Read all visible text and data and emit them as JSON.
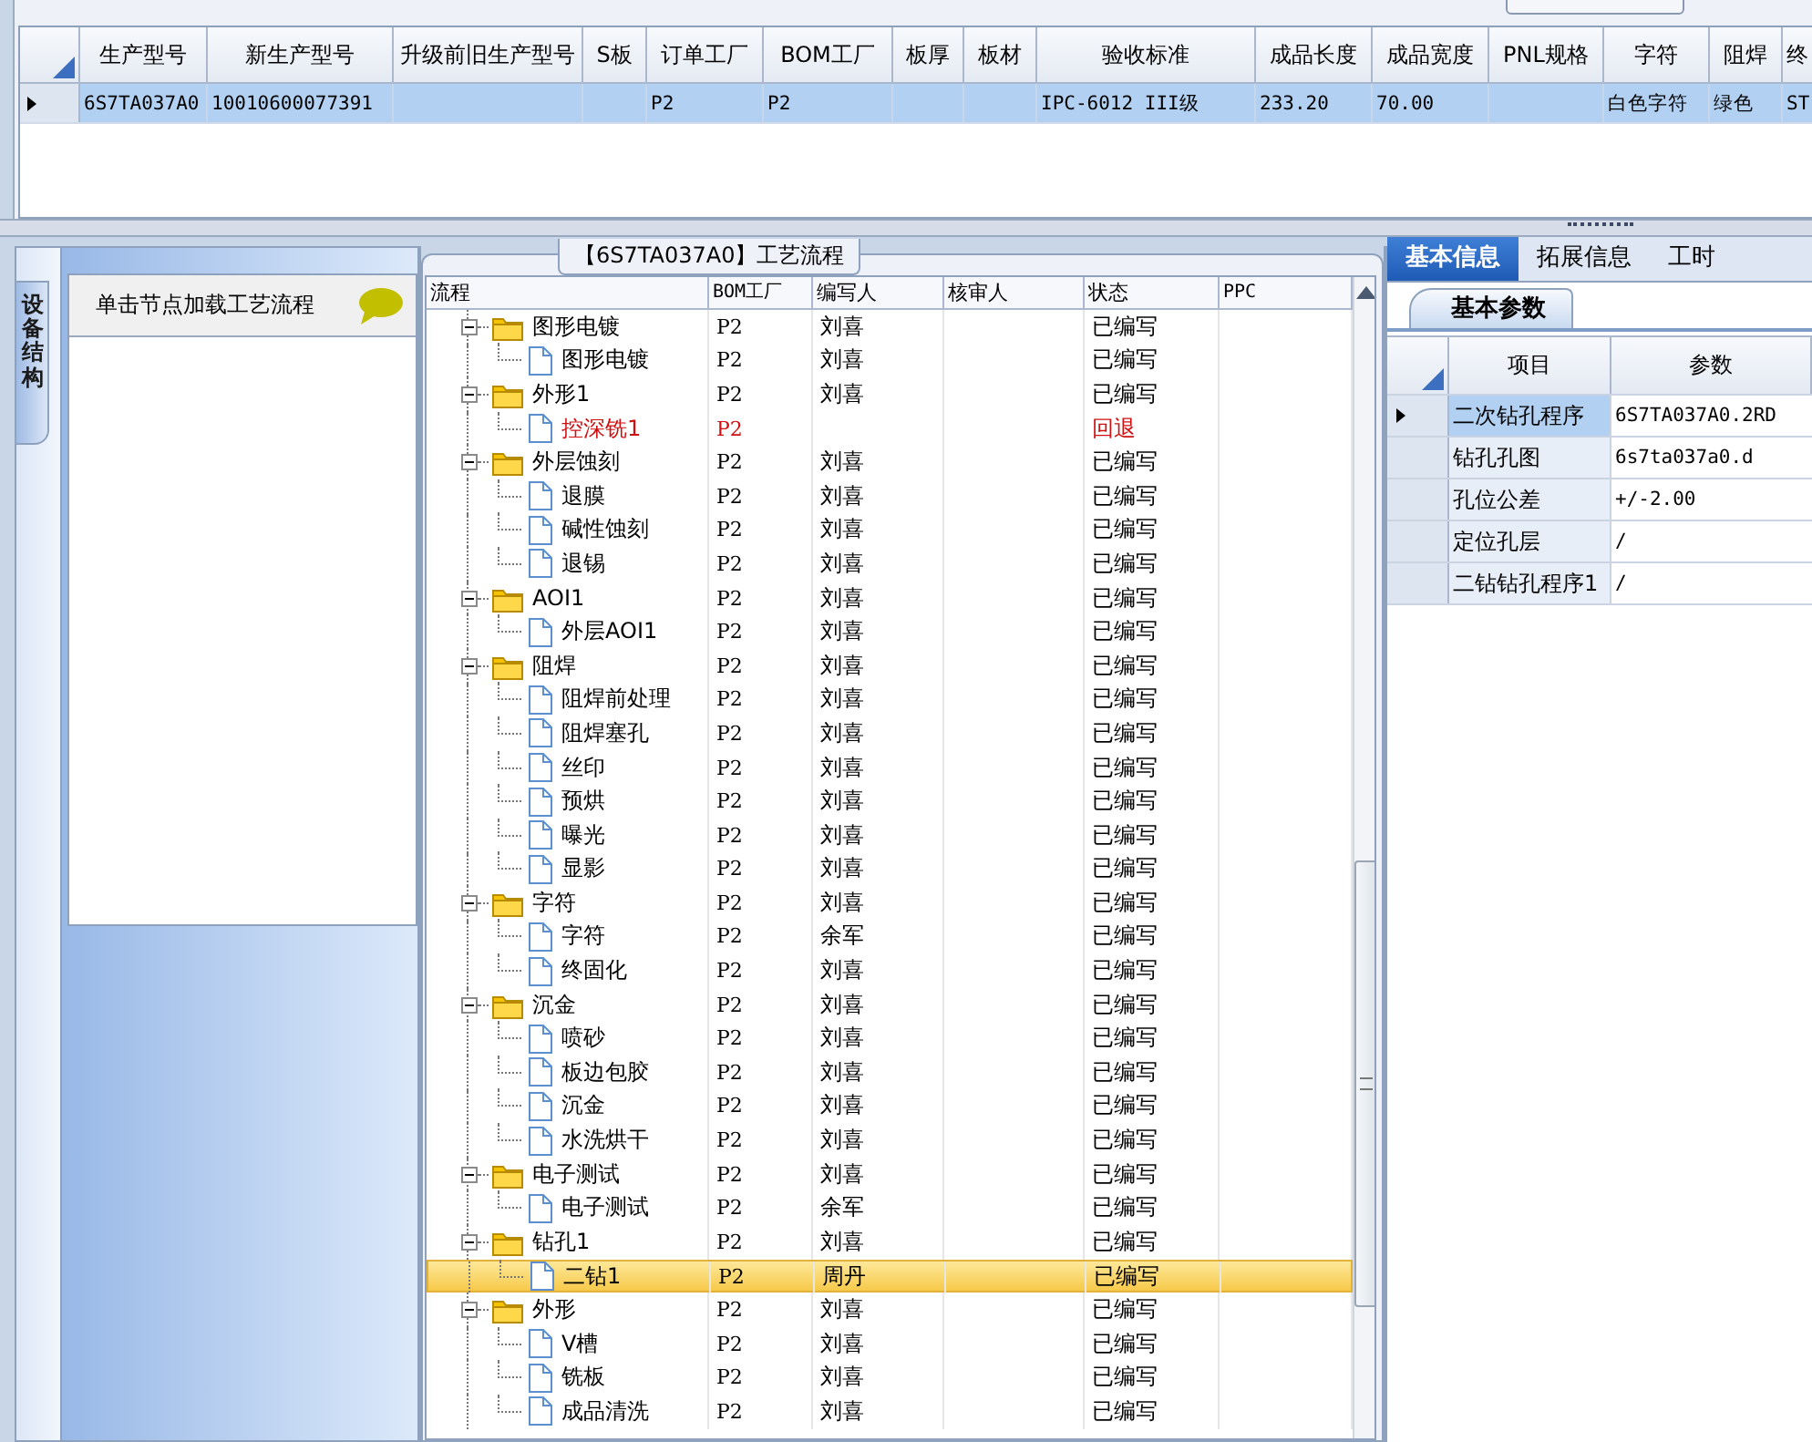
{
  "main_grid": {
    "columns": [
      "生产型号",
      "新生产型号",
      "升级前旧生产型号",
      "S板",
      "订单工厂",
      "BOM工厂",
      "板厚",
      "板材",
      "验收标准",
      "成品长度",
      "成品宽度",
      "PNL规格",
      "字符",
      "阻焊",
      "终"
    ],
    "rows": [
      {
        "selected": true,
        "cells": [
          "6S7TA037A0",
          "10010600077391",
          "",
          "",
          "P2",
          "P2",
          "",
          "",
          "IPC-6012 III级",
          "233.20",
          "70.00",
          "",
          "白色字符",
          "绿色",
          "ST"
        ]
      }
    ]
  },
  "left_panel": {
    "side_tab": "设备结构",
    "hint": "单击节点加载工艺流程"
  },
  "process_panel": {
    "title": "【6S7TA037A0】工艺流程",
    "columns": [
      "流程",
      "BOM工厂",
      "编写人",
      "核审人",
      "状态",
      "PPC"
    ],
    "tree": [
      {
        "name": "图形电镀",
        "bom": "P2",
        "writer": "刘喜",
        "status": "已编写",
        "expanded": true,
        "selected": false,
        "rejected": false,
        "children": [
          {
            "name": "图形电镀",
            "bom": "P2",
            "writer": "刘喜",
            "status": "已编写",
            "selected": false,
            "rejected": false
          }
        ]
      },
      {
        "name": "外形1",
        "bom": "P2",
        "writer": "刘喜",
        "status": "已编写",
        "expanded": true,
        "selected": false,
        "rejected": false,
        "children": [
          {
            "name": "控深铣1",
            "bom": "P2",
            "status": "回退",
            "selected": false,
            "rejected": true
          }
        ]
      },
      {
        "name": "外层蚀刻",
        "bom": "P2",
        "writer": "刘喜",
        "status": "已编写",
        "expanded": true,
        "selected": false,
        "rejected": false,
        "children": [
          {
            "name": "退膜",
            "bom": "P2",
            "writer": "刘喜",
            "status": "已编写",
            "selected": false,
            "rejected": false
          },
          {
            "name": "碱性蚀刻",
            "bom": "P2",
            "writer": "刘喜",
            "status": "已编写",
            "selected": false,
            "rejected": false
          },
          {
            "name": "退锡",
            "bom": "P2",
            "writer": "刘喜",
            "status": "已编写",
            "selected": false,
            "rejected": false
          }
        ]
      },
      {
        "name": "AOI1",
        "bom": "P2",
        "writer": "刘喜",
        "status": "已编写",
        "expanded": true,
        "selected": false,
        "rejected": false,
        "children": [
          {
            "name": "外层AOI1",
            "bom": "P2",
            "writer": "刘喜",
            "status": "已编写",
            "selected": false,
            "rejected": false
          }
        ]
      },
      {
        "name": "阻焊",
        "bom": "P2",
        "writer": "刘喜",
        "status": "已编写",
        "expanded": true,
        "selected": false,
        "rejected": false,
        "children": [
          {
            "name": "阻焊前处理",
            "bom": "P2",
            "writer": "刘喜",
            "status": "已编写",
            "selected": false,
            "rejected": false
          },
          {
            "name": "阻焊塞孔",
            "bom": "P2",
            "writer": "刘喜",
            "status": "已编写",
            "selected": false,
            "rejected": false
          },
          {
            "name": "丝印",
            "bom": "P2",
            "writer": "刘喜",
            "status": "已编写",
            "selected": false,
            "rejected": false
          },
          {
            "name": "预烘",
            "bom": "P2",
            "writer": "刘喜",
            "status": "已编写",
            "selected": false,
            "rejected": false
          },
          {
            "name": "曝光",
            "bom": "P2",
            "writer": "刘喜",
            "status": "已编写",
            "selected": false,
            "rejected": false
          },
          {
            "name": "显影",
            "bom": "P2",
            "writer": "刘喜",
            "status": "已编写",
            "selected": false,
            "rejected": false
          }
        ]
      },
      {
        "name": "字符",
        "bom": "P2",
        "writer": "刘喜",
        "status": "已编写",
        "expanded": true,
        "selected": false,
        "rejected": false,
        "children": [
          {
            "name": "字符",
            "bom": "P2",
            "writer": "余军",
            "status": "已编写",
            "selected": false,
            "rejected": false
          },
          {
            "name": "终固化",
            "bom": "P2",
            "writer": "刘喜",
            "status": "已编写",
            "selected": false,
            "rejected": false
          }
        ]
      },
      {
        "name": "沉金",
        "bom": "P2",
        "writer": "刘喜",
        "status": "已编写",
        "expanded": true,
        "selected": false,
        "rejected": false,
        "children": [
          {
            "name": "喷砂",
            "bom": "P2",
            "writer": "刘喜",
            "status": "已编写",
            "selected": false,
            "rejected": false
          },
          {
            "name": "板边包胶",
            "bom": "P2",
            "writer": "刘喜",
            "status": "已编写",
            "selected": false,
            "rejected": false
          },
          {
            "name": "沉金",
            "bom": "P2",
            "writer": "刘喜",
            "status": "已编写",
            "selected": false,
            "rejected": false
          },
          {
            "name": "水洗烘干",
            "bom": "P2",
            "writer": "刘喜",
            "status": "已编写",
            "selected": false,
            "rejected": false
          }
        ]
      },
      {
        "name": "电子测试",
        "bom": "P2",
        "writer": "刘喜",
        "status": "已编写",
        "expanded": true,
        "selected": false,
        "rejected": false,
        "children": [
          {
            "name": "电子测试",
            "bom": "P2",
            "writer": "余军",
            "status": "已编写",
            "selected": false,
            "rejected": false
          }
        ]
      },
      {
        "name": "钻孔1",
        "bom": "P2",
        "writer": "刘喜",
        "status": "已编写",
        "expanded": true,
        "selected": false,
        "rejected": false,
        "children": [
          {
            "name": "二钻1",
            "bom": "P2",
            "writer": "周丹",
            "status": "已编写",
            "selected": true,
            "rejected": false
          }
        ]
      },
      {
        "name": "外形",
        "bom": "P2",
        "writer": "刘喜",
        "status": "已编写",
        "expanded": true,
        "selected": false,
        "rejected": false,
        "children": [
          {
            "name": "V槽",
            "bom": "P2",
            "writer": "刘喜",
            "status": "已编写",
            "selected": false,
            "rejected": false
          },
          {
            "name": "铣板",
            "bom": "P2",
            "writer": "刘喜",
            "status": "已编写",
            "selected": false,
            "rejected": false
          },
          {
            "name": "成品清洗",
            "bom": "P2",
            "writer": "刘喜",
            "status": "已编写",
            "selected": false,
            "rejected": false
          }
        ]
      }
    ]
  },
  "info_panel": {
    "tabs": [
      {
        "label": "基本信息",
        "selected": true
      },
      {
        "label": "拓展信息",
        "selected": false
      },
      {
        "label": "工时",
        "selected": false
      }
    ],
    "sub_tab": "基本参数",
    "columns": [
      "项目",
      "参数"
    ],
    "rows": [
      {
        "item": "二次钻孔程序",
        "value": "6S7TA037A0.2RD",
        "selected": true
      },
      {
        "item": "钻孔孔图",
        "value": "6s7ta037a0.d",
        "selected": false
      },
      {
        "item": "孔位公差",
        "value": "+/-2.00",
        "selected": false
      },
      {
        "item": "定位孔层",
        "value": "/",
        "selected": false
      },
      {
        "item": "二钻钻孔程序1",
        "value": "/",
        "selected": false
      }
    ]
  }
}
